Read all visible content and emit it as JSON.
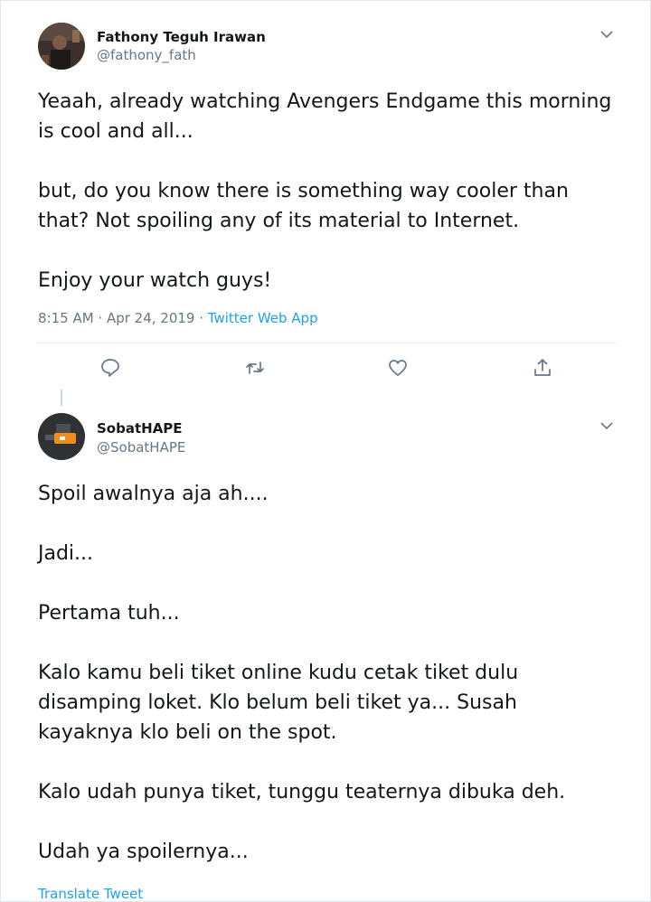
{
  "tweet1": {
    "name": "Fathony Teguh Irawan",
    "handle": "@fathony_fath",
    "paragraphs": [
      "Yeaah, already watching Avengers Endgame this morning\nis cool and all...",
      "but, do you know there is something way cooler than\nthat? Not spoiling any of its material to Internet.",
      "Enjoy your watch guys!"
    ],
    "time": "8:15 AM · Apr 24, 2019 · ",
    "source": "Twitter Web App"
  },
  "tweet2": {
    "name": "SobatHAPE",
    "handle": "@SobatHAPE",
    "paragraphs": [
      "Spoil awalnya aja ah....",
      "Jadi...",
      "Pertama tuh...",
      "Kalo kamu beli tiket online kudu cetak tiket dulu\ndisamping loket. Klo belum beli tiket ya... Susah\nkayaknya klo beli on the spot.",
      "Kalo udah punya tiket, tunggu teaternya dibuka deh.",
      "Udah ya spoilernya..."
    ],
    "translate": "Translate Tweet"
  },
  "icons": [
    "chevron-down-icon",
    "reply-icon",
    "retweet-icon",
    "like-icon",
    "share-icon"
  ],
  "colors": {
    "link": "#1da1f2",
    "muted": "#657786",
    "text": "#14171a"
  }
}
